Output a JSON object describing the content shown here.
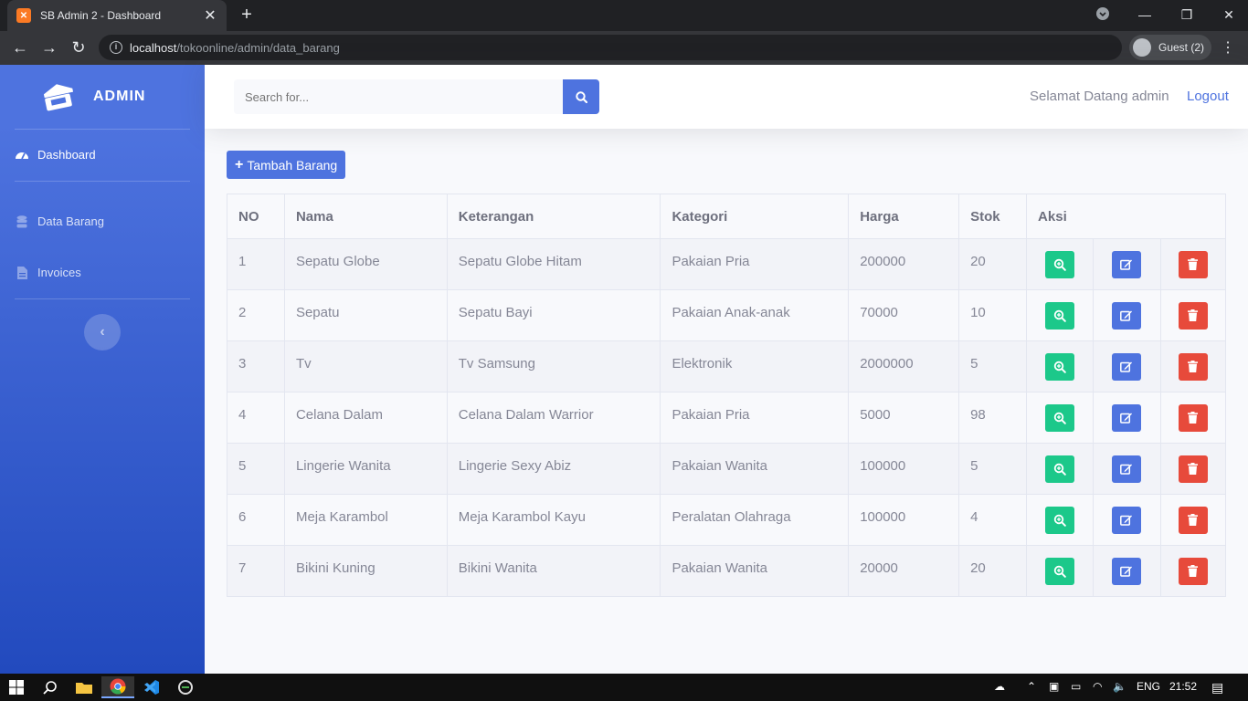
{
  "browser": {
    "tab_title": "SB Admin 2 - Dashboard",
    "url_host": "localhost",
    "url_path": "/tokoonline/admin/data_barang",
    "profile_label": "Guest (2)"
  },
  "sidebar": {
    "brand": "ADMIN",
    "items": [
      {
        "label": "Dashboard",
        "icon": "tachometer-icon"
      },
      {
        "label": "Data Barang",
        "icon": "database-icon"
      },
      {
        "label": "Invoices",
        "icon": "file-icon"
      }
    ]
  },
  "topbar": {
    "search_placeholder": "Search for...",
    "welcome": "Selamat Datang admin",
    "logout": "Logout"
  },
  "main": {
    "add_button": "Tambah Barang",
    "columns": [
      "NO",
      "Nama",
      "Keterangan",
      "Kategori",
      "Harga",
      "Stok",
      "Aksi"
    ],
    "rows": [
      [
        "1",
        "Sepatu Globe",
        "Sepatu Globe Hitam",
        "Pakaian Pria",
        "200000",
        "20"
      ],
      [
        "2",
        "Sepatu",
        "Sepatu Bayi",
        "Pakaian Anak-anak",
        "70000",
        "10"
      ],
      [
        "3",
        "Tv",
        "Tv Samsung",
        "Elektronik",
        "2000000",
        "5"
      ],
      [
        "4",
        "Celana Dalam",
        "Celana Dalam Warrior",
        "Pakaian Pria",
        "5000",
        "98"
      ],
      [
        "5",
        "Lingerie Wanita",
        "Lingerie Sexy Abiz",
        "Pakaian Wanita",
        "100000",
        "5"
      ],
      [
        "6",
        "Meja Karambol",
        "Meja Karambol Kayu",
        "Peralatan Olahraga",
        "100000",
        "4"
      ],
      [
        "7",
        "Bikini Kuning",
        "Bikini Wanita",
        "Pakaian Wanita",
        "20000",
        "20"
      ]
    ]
  },
  "taskbar": {
    "lang": "ENG",
    "time": "21:52"
  },
  "colors": {
    "primary": "#4e73df",
    "success": "#1cc88a",
    "danger": "#e74a3b"
  }
}
